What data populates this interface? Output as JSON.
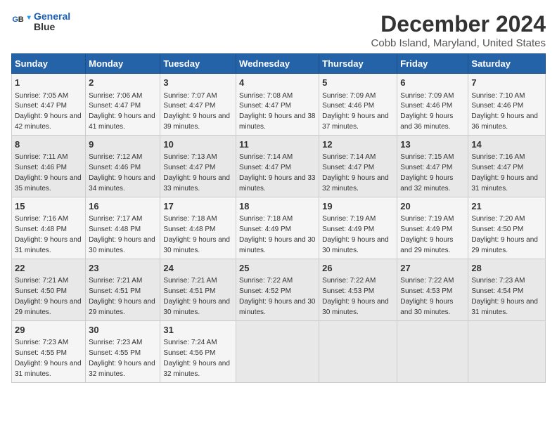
{
  "logo": {
    "line1": "General",
    "line2": "Blue"
  },
  "title": "December 2024",
  "subtitle": "Cobb Island, Maryland, United States",
  "days_header": [
    "Sunday",
    "Monday",
    "Tuesday",
    "Wednesday",
    "Thursday",
    "Friday",
    "Saturday"
  ],
  "weeks": [
    [
      {
        "day": "1",
        "rise": "Sunrise: 7:05 AM",
        "set": "Sunset: 4:47 PM",
        "daylight": "Daylight: 9 hours and 42 minutes."
      },
      {
        "day": "2",
        "rise": "Sunrise: 7:06 AM",
        "set": "Sunset: 4:47 PM",
        "daylight": "Daylight: 9 hours and 41 minutes."
      },
      {
        "day": "3",
        "rise": "Sunrise: 7:07 AM",
        "set": "Sunset: 4:47 PM",
        "daylight": "Daylight: 9 hours and 39 minutes."
      },
      {
        "day": "4",
        "rise": "Sunrise: 7:08 AM",
        "set": "Sunset: 4:47 PM",
        "daylight": "Daylight: 9 hours and 38 minutes."
      },
      {
        "day": "5",
        "rise": "Sunrise: 7:09 AM",
        "set": "Sunset: 4:46 PM",
        "daylight": "Daylight: 9 hours and 37 minutes."
      },
      {
        "day": "6",
        "rise": "Sunrise: 7:09 AM",
        "set": "Sunset: 4:46 PM",
        "daylight": "Daylight: 9 hours and 36 minutes."
      },
      {
        "day": "7",
        "rise": "Sunrise: 7:10 AM",
        "set": "Sunset: 4:46 PM",
        "daylight": "Daylight: 9 hours and 36 minutes."
      }
    ],
    [
      {
        "day": "8",
        "rise": "Sunrise: 7:11 AM",
        "set": "Sunset: 4:46 PM",
        "daylight": "Daylight: 9 hours and 35 minutes."
      },
      {
        "day": "9",
        "rise": "Sunrise: 7:12 AM",
        "set": "Sunset: 4:46 PM",
        "daylight": "Daylight: 9 hours and 34 minutes."
      },
      {
        "day": "10",
        "rise": "Sunrise: 7:13 AM",
        "set": "Sunset: 4:47 PM",
        "daylight": "Daylight: 9 hours and 33 minutes."
      },
      {
        "day": "11",
        "rise": "Sunrise: 7:14 AM",
        "set": "Sunset: 4:47 PM",
        "daylight": "Daylight: 9 hours and 33 minutes."
      },
      {
        "day": "12",
        "rise": "Sunrise: 7:14 AM",
        "set": "Sunset: 4:47 PM",
        "daylight": "Daylight: 9 hours and 32 minutes."
      },
      {
        "day": "13",
        "rise": "Sunrise: 7:15 AM",
        "set": "Sunset: 4:47 PM",
        "daylight": "Daylight: 9 hours and 32 minutes."
      },
      {
        "day": "14",
        "rise": "Sunrise: 7:16 AM",
        "set": "Sunset: 4:47 PM",
        "daylight": "Daylight: 9 hours and 31 minutes."
      }
    ],
    [
      {
        "day": "15",
        "rise": "Sunrise: 7:16 AM",
        "set": "Sunset: 4:48 PM",
        "daylight": "Daylight: 9 hours and 31 minutes."
      },
      {
        "day": "16",
        "rise": "Sunrise: 7:17 AM",
        "set": "Sunset: 4:48 PM",
        "daylight": "Daylight: 9 hours and 30 minutes."
      },
      {
        "day": "17",
        "rise": "Sunrise: 7:18 AM",
        "set": "Sunset: 4:48 PM",
        "daylight": "Daylight: 9 hours and 30 minutes."
      },
      {
        "day": "18",
        "rise": "Sunrise: 7:18 AM",
        "set": "Sunset: 4:49 PM",
        "daylight": "Daylight: 9 hours and 30 minutes."
      },
      {
        "day": "19",
        "rise": "Sunrise: 7:19 AM",
        "set": "Sunset: 4:49 PM",
        "daylight": "Daylight: 9 hours and 30 minutes."
      },
      {
        "day": "20",
        "rise": "Sunrise: 7:19 AM",
        "set": "Sunset: 4:49 PM",
        "daylight": "Daylight: 9 hours and 29 minutes."
      },
      {
        "day": "21",
        "rise": "Sunrise: 7:20 AM",
        "set": "Sunset: 4:50 PM",
        "daylight": "Daylight: 9 hours and 29 minutes."
      }
    ],
    [
      {
        "day": "22",
        "rise": "Sunrise: 7:21 AM",
        "set": "Sunset: 4:50 PM",
        "daylight": "Daylight: 9 hours and 29 minutes."
      },
      {
        "day": "23",
        "rise": "Sunrise: 7:21 AM",
        "set": "Sunset: 4:51 PM",
        "daylight": "Daylight: 9 hours and 29 minutes."
      },
      {
        "day": "24",
        "rise": "Sunrise: 7:21 AM",
        "set": "Sunset: 4:51 PM",
        "daylight": "Daylight: 9 hours and 30 minutes."
      },
      {
        "day": "25",
        "rise": "Sunrise: 7:22 AM",
        "set": "Sunset: 4:52 PM",
        "daylight": "Daylight: 9 hours and 30 minutes."
      },
      {
        "day": "26",
        "rise": "Sunrise: 7:22 AM",
        "set": "Sunset: 4:53 PM",
        "daylight": "Daylight: 9 hours and 30 minutes."
      },
      {
        "day": "27",
        "rise": "Sunrise: 7:22 AM",
        "set": "Sunset: 4:53 PM",
        "daylight": "Daylight: 9 hours and 30 minutes."
      },
      {
        "day": "28",
        "rise": "Sunrise: 7:23 AM",
        "set": "Sunset: 4:54 PM",
        "daylight": "Daylight: 9 hours and 31 minutes."
      }
    ],
    [
      {
        "day": "29",
        "rise": "Sunrise: 7:23 AM",
        "set": "Sunset: 4:55 PM",
        "daylight": "Daylight: 9 hours and 31 minutes."
      },
      {
        "day": "30",
        "rise": "Sunrise: 7:23 AM",
        "set": "Sunset: 4:55 PM",
        "daylight": "Daylight: 9 hours and 32 minutes."
      },
      {
        "day": "31",
        "rise": "Sunrise: 7:24 AM",
        "set": "Sunset: 4:56 PM",
        "daylight": "Daylight: 9 hours and 32 minutes."
      },
      null,
      null,
      null,
      null
    ]
  ]
}
